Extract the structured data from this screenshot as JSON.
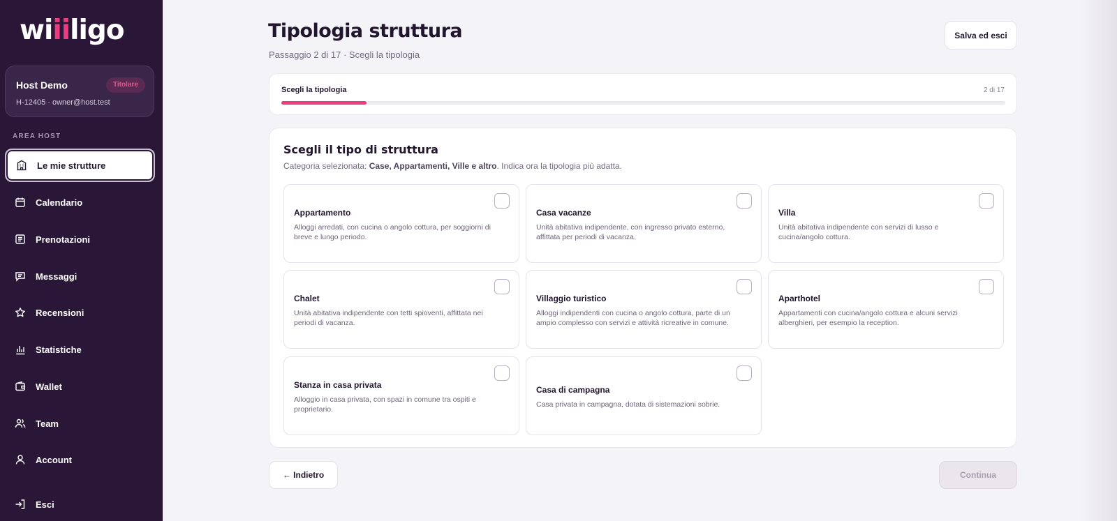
{
  "brand": {
    "logo_pre": "wi",
    "logo_accent": "ii",
    "logo_post": "ligo",
    "accent_color": "#ec3b7f",
    "sidebar_color": "#2a1738"
  },
  "host": {
    "name": "Host Demo",
    "badge": "Titolare",
    "meta": "H-12405 · owner@host.test"
  },
  "sidebar": {
    "section_label": "AREA HOST",
    "items": [
      {
        "label": "Le mie strutture",
        "icon": "building-icon",
        "active": true
      },
      {
        "label": "Calendario",
        "icon": "calendar-icon"
      },
      {
        "label": "Prenotazioni",
        "icon": "list-icon"
      },
      {
        "label": "Messaggi",
        "icon": "chat-icon"
      },
      {
        "label": "Recensioni",
        "icon": "star-icon"
      },
      {
        "label": "Statistiche",
        "icon": "bar-chart-icon"
      },
      {
        "label": "Wallet",
        "icon": "wallet-icon"
      },
      {
        "label": "Team",
        "icon": "team-icon"
      },
      {
        "label": "Account",
        "icon": "user-icon"
      }
    ],
    "logout": {
      "label": "Esci",
      "icon": "logout-icon"
    }
  },
  "header": {
    "title": "Tipologia struttura",
    "subtitle": "Passaggio 2 di 17 · Scegli la tipologia",
    "save_label": "Salva ed esci"
  },
  "progress": {
    "label": "Scegli la tipologia",
    "count": "2 di 17",
    "value": 0.118
  },
  "section": {
    "title": "Scegli il tipo di struttura",
    "desc_prefix": "Categoria selezionata: ",
    "desc_category": "Case, Appartamenti, Ville e altro",
    "desc_suffix": ". Indica ora la tipologia più adatta."
  },
  "options": [
    {
      "title": "Appartamento",
      "desc": "Alloggi arredati, con cucina o angolo cottura, per soggiorni di breve e lungo periodo.",
      "checked": false
    },
    {
      "title": "Casa vacanze",
      "desc": "Unità abitativa indipendente, con ingresso privato esterno, affittata per periodi di vacanza.",
      "checked": false
    },
    {
      "title": "Villa",
      "desc": "Unità abitativa indipendente con servizi di lusso e cucina/angolo cottura.",
      "checked": false
    },
    {
      "title": "Chalet",
      "desc": "Unità abitativa indipendente con tetti spioventi, affittata nei periodi di vacanza.",
      "checked": false
    },
    {
      "title": "Villaggio turistico",
      "desc": "Alloggi indipendenti con cucina o angolo cottura, parte di un ampio complesso con servizi e attività ricreative in comune.",
      "checked": false
    },
    {
      "title": "Aparthotel",
      "desc": "Appartamenti con cucina/angolo cottura e alcuni servizi alberghieri, per esempio la reception.",
      "checked": false
    },
    {
      "title": "Stanza in casa privata",
      "desc": "Alloggio in casa privata, con spazi in comune tra ospiti e proprietario.",
      "checked": false
    },
    {
      "title": "Casa di campagna",
      "desc": "Casa privata in campagna, dotata di sistemazioni sobrie.",
      "checked": false
    }
  ],
  "footer": {
    "back_label": "← Indietro",
    "continue_label": "Continua"
  }
}
